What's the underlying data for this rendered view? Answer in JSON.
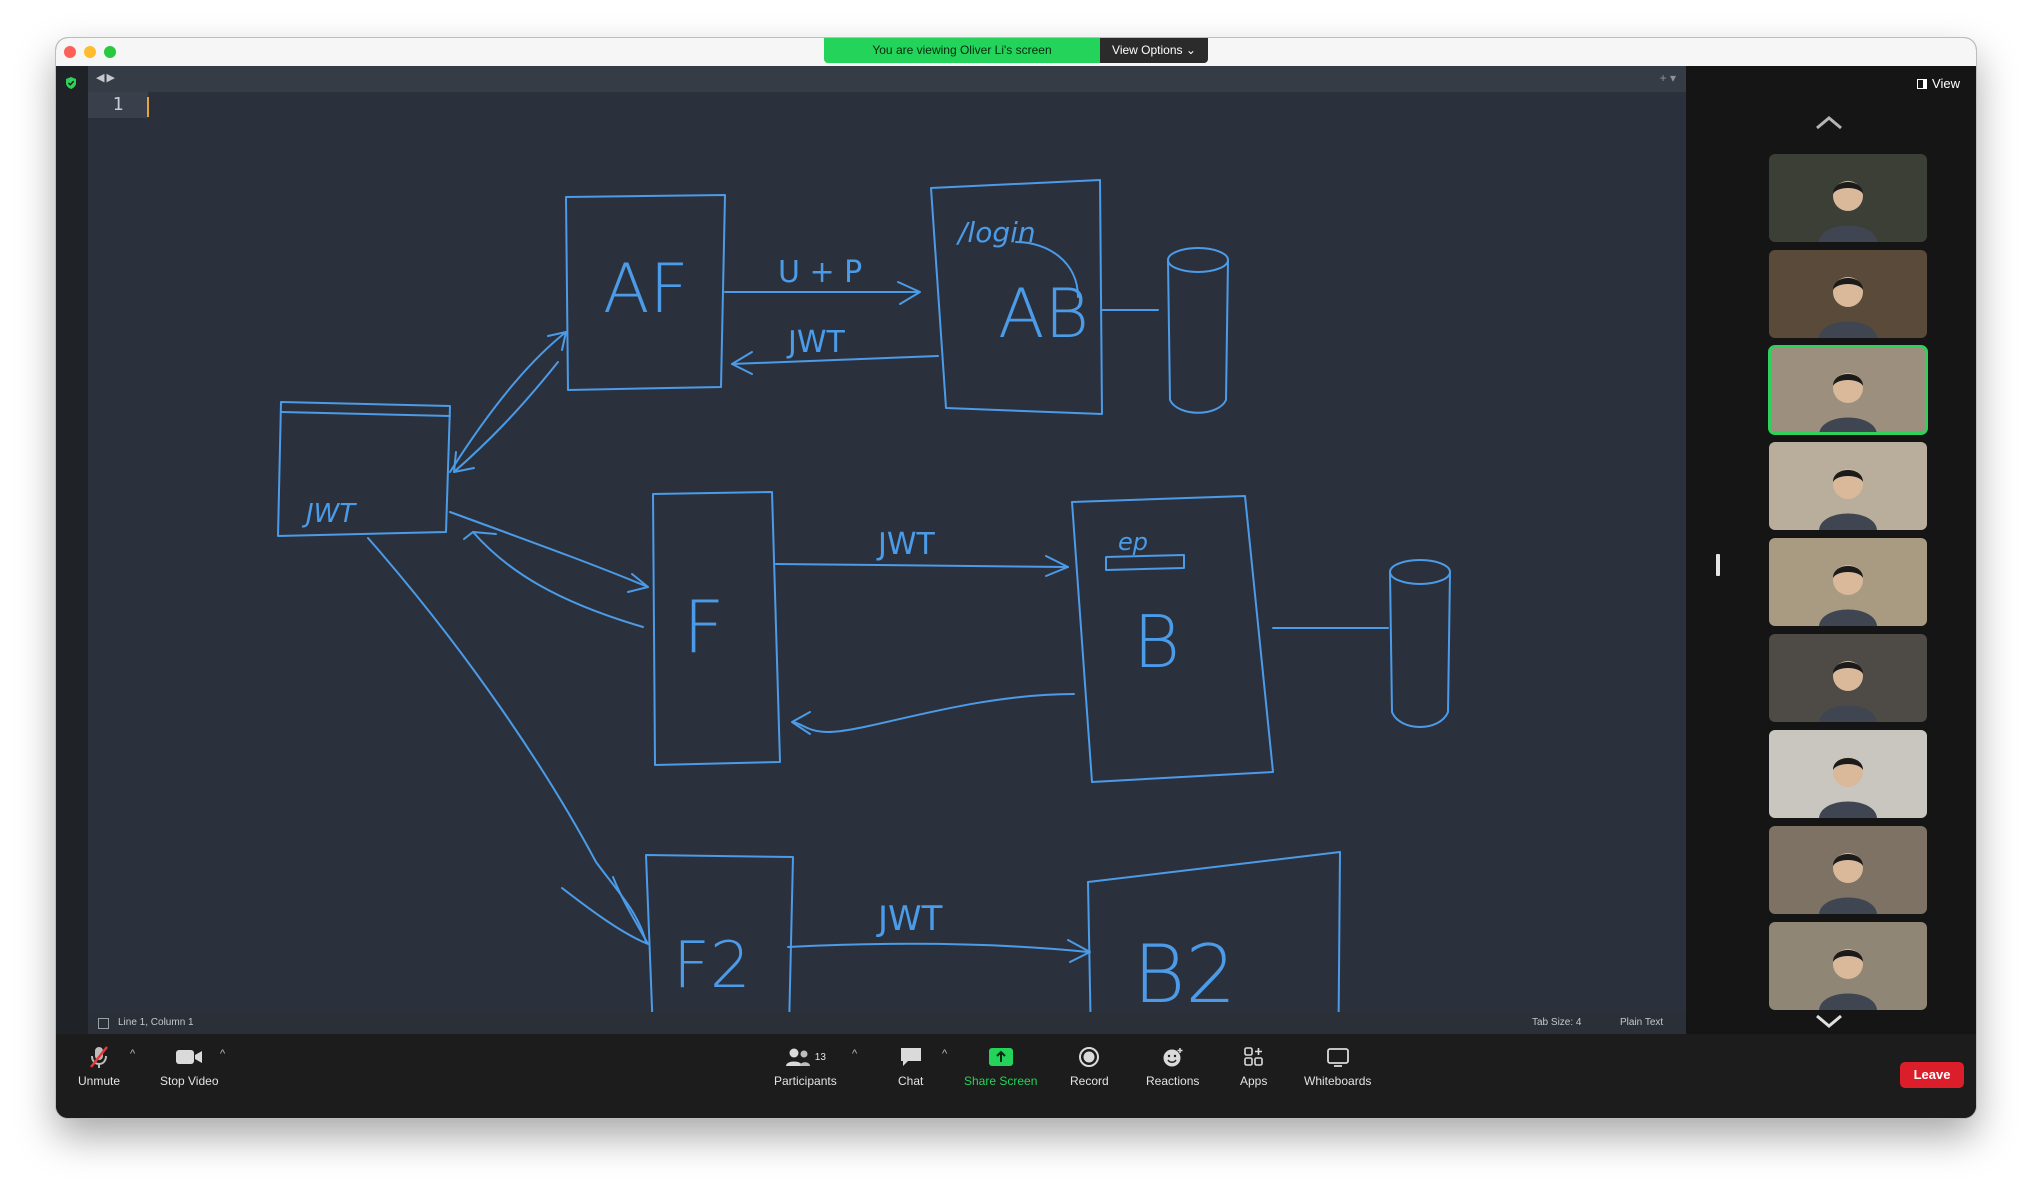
{
  "banner": {
    "text": "You are viewing Oliver Li's screen",
    "options_label": "View Options",
    "color": "#23d35a"
  },
  "editor": {
    "line_number": "1",
    "status_position": "Line 1, Column 1",
    "status_tab_size": "Tab Size: 4",
    "status_mode": "Plain Text"
  },
  "whiteboard": {
    "stroke_color": "#4b9be8",
    "labels": {
      "af": "AF",
      "ab": "AB",
      "login": "/login",
      "up": "U + P",
      "jwt_ab": "JWT",
      "client_jwt": "JWT",
      "f": "F",
      "jwt_fb": "JWT",
      "ep": "ep",
      "b": "B",
      "f2": "F2",
      "jwt_f2": "JWT",
      "b2": "B2"
    }
  },
  "gallery": {
    "view_label": "View",
    "tiles": [
      {
        "name": "participant-1",
        "bg": "#3b3f36"
      },
      {
        "name": "participant-2",
        "bg": "#5a4a3a"
      },
      {
        "name": "participant-3",
        "bg": "#9c8f7d",
        "active": true
      },
      {
        "name": "participant-4",
        "bg": "#b9ad9c"
      },
      {
        "name": "participant-5",
        "bg": "#a99a82"
      },
      {
        "name": "participant-6",
        "bg": "#4e4a46"
      },
      {
        "name": "participant-7",
        "bg": "#c9c6bf"
      },
      {
        "name": "participant-8",
        "bg": "#7e7264"
      },
      {
        "name": "participant-9",
        "bg": "#8f8676"
      }
    ],
    "active_color": "#2fd15b"
  },
  "toolbar": {
    "unmute": "Unmute",
    "stop_video": "Stop Video",
    "participants": "Participants",
    "participants_count": "13",
    "chat": "Chat",
    "share_screen": "Share Screen",
    "record": "Record",
    "reactions": "Reactions",
    "apps": "Apps",
    "whiteboards": "Whiteboards",
    "leave": "Leave",
    "share_color": "#23d35a",
    "leave_color": "#dc1e2b"
  }
}
